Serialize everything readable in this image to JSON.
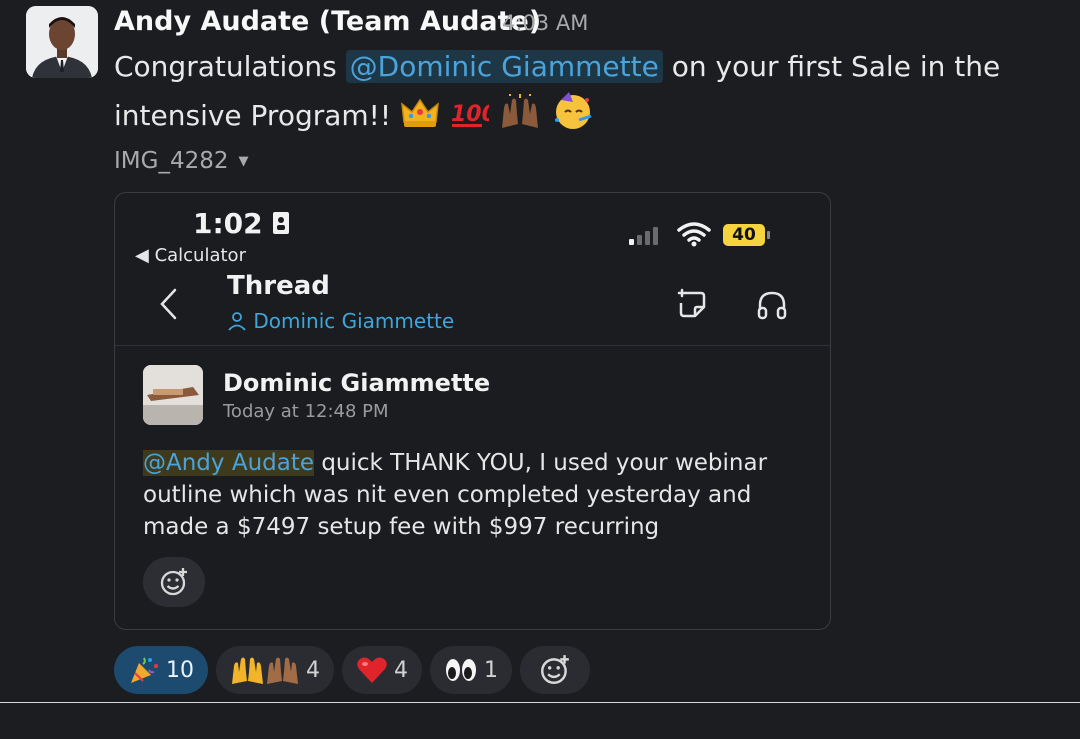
{
  "message": {
    "author": "Andy Audate (Team Audate)",
    "time": "4:03 AM",
    "text_before": "Congratulations ",
    "mention": "@Dominic Giammette",
    "text_after": " on your first Sale in the intensive Program!! ",
    "emojis": [
      "crown-emoji",
      "hundred-points-emoji",
      "raising-hands-emoji",
      "partying-face-emoji"
    ]
  },
  "attachment": {
    "filename": "IMG_4282"
  },
  "screenshot": {
    "phone_time": "1:02",
    "back_app": "◀ Calculator",
    "battery": "40",
    "thread_title": "Thread",
    "thread_user": "Dominic Giammette",
    "post": {
      "author": "Dominic Giammette",
      "timestamp": "Today at 12:48 PM",
      "mention": "@Andy Audate",
      "text": " quick THANK YOU, I used your webinar outline which was nit even completed yesterday and made a $7497 setup fee with $997 recurring"
    }
  },
  "reactions": [
    {
      "emoji": "party-popper-emoji",
      "count": "10",
      "active": true
    },
    {
      "emoji": "raising-hands-emoji",
      "count": "4",
      "active": false
    },
    {
      "emoji": "red-heart-emoji",
      "count": "4",
      "active": false
    },
    {
      "emoji": "eyes-emoji",
      "count": "1",
      "active": false
    }
  ],
  "colors": {
    "background": "#1b1d21",
    "mention_text": "#4ba3d9",
    "mention_bg": "#1e3747",
    "active_reaction": "#1d4b6f",
    "battery": "#f5d43d"
  }
}
